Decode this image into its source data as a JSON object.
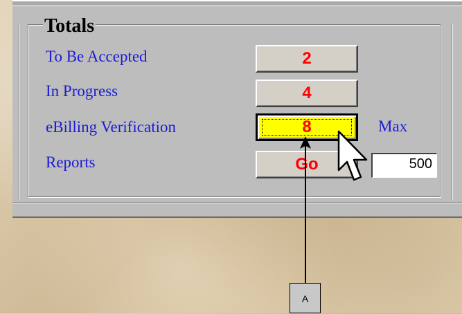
{
  "totals": {
    "title": "Totals",
    "rows": [
      {
        "label": "To Be Accepted",
        "value": "2"
      },
      {
        "label": "In Progress",
        "value": "4"
      },
      {
        "label": "eBilling Verification",
        "value": "8"
      },
      {
        "label": "Reports",
        "value": "Go"
      }
    ],
    "max_label": "Max",
    "max_value": "500"
  },
  "annotation": {
    "label": "A"
  },
  "colors": {
    "label_text": "#1b1bd6",
    "button_text": "#ff0000",
    "focused_button_bg": "#ffff00",
    "panel_bg": "#bdbdbd"
  },
  "icons": {
    "cursor": "arrow-cursor-icon"
  }
}
